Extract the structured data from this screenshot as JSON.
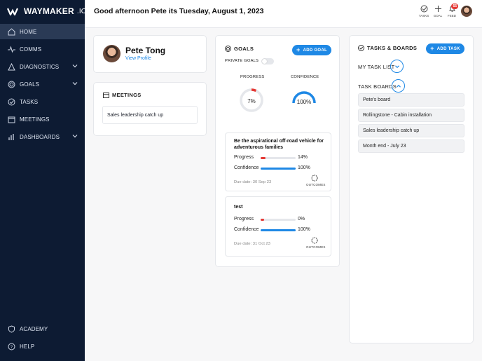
{
  "app": {
    "logo_text": "WAYMAKER",
    "logo_suffix": ".IO"
  },
  "sidebar": {
    "items": [
      {
        "label": "HOME",
        "icon": "home-icon",
        "active": true
      },
      {
        "label": "COMMS",
        "icon": "pulse-icon"
      },
      {
        "label": "DIAGNOSTICS",
        "icon": "triangle-icon",
        "expandable": true
      },
      {
        "label": "GOALS",
        "icon": "target-icon",
        "expandable": true
      },
      {
        "label": "TASKS",
        "icon": "check-circle-icon"
      },
      {
        "label": "MEETINGS",
        "icon": "calendar-icon"
      },
      {
        "label": "DASHBOARDS",
        "icon": "bar-chart-icon",
        "expandable": true
      }
    ],
    "bottom": [
      {
        "label": "ACADEMY",
        "icon": "shield-icon"
      },
      {
        "label": "HELP",
        "icon": "help-icon"
      }
    ]
  },
  "header": {
    "greeting": "Good afternoon Pete its Tuesday, August 1, 2023",
    "tasks_label": "TASKS",
    "goal_label": "GOAL",
    "feed_label": "FEED",
    "feed_count": "55"
  },
  "profile": {
    "name": "Pete Tong",
    "link": "View Profile"
  },
  "meetings": {
    "title": "MEETINGS",
    "items": [
      "Sales leadership catch up"
    ]
  },
  "goals": {
    "title": "GOALS",
    "add_label": "ADD GOAL",
    "private_label": "PRIVATE GOALS",
    "progress_label": "PROGRESS",
    "confidence_label": "CONFIDENCE",
    "progress_value": "7%",
    "confidence_value": "100%",
    "progress_fraction": 0.07,
    "confidence_fraction": 1.0,
    "progress_row_label": "Progress",
    "confidence_row_label": "Confidence",
    "outcomes_label": "OUTCOMES",
    "list": [
      {
        "title": "Be the aspirational off-road vehicle for adventurous families",
        "progress": "14%",
        "progress_fraction": 0.14,
        "confidence": "100%",
        "confidence_fraction": 1.0,
        "due": "Due date: 30 Sep 23"
      },
      {
        "title": "test",
        "progress": "0%",
        "progress_fraction": 0.0,
        "confidence": "100%",
        "confidence_fraction": 1.0,
        "due": "Due date: 31 Oct 23"
      }
    ]
  },
  "tasks": {
    "title": "TASKS & BOARDS",
    "add_label": "ADD TASK",
    "my_list_label": "MY TASK LIST",
    "boards_label": "TASK BOARDS",
    "boards": [
      "Pete's board",
      "Rollingstone - Cabin installation",
      "Sales leadership catch up",
      "Month end - July 23"
    ]
  },
  "colors": {
    "accent": "#1e88e5",
    "sidebar": "#0d1b33",
    "progress_red": "#e53935"
  }
}
